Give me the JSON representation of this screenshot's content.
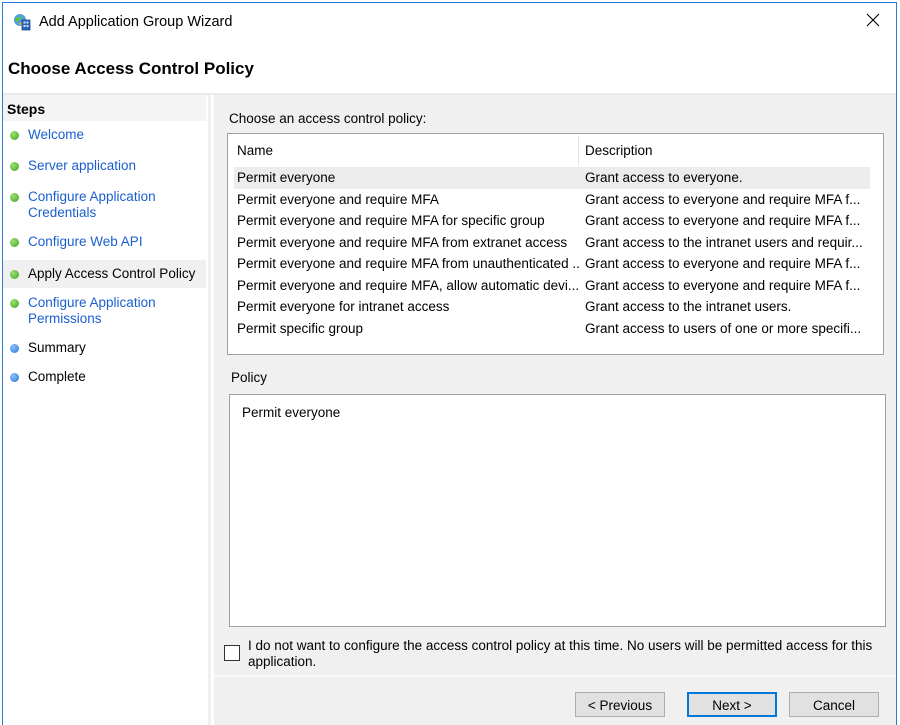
{
  "window": {
    "title": "Add Application Group Wizard",
    "app_icon": "adfs-app-icon",
    "close_icon": "close-icon"
  },
  "page_title": "Choose Access Control Policy",
  "steps": {
    "heading": "Steps",
    "items": [
      {
        "label": "Welcome",
        "status": "completed",
        "style": "link"
      },
      {
        "label": "Server application",
        "status": "completed",
        "style": "link"
      },
      {
        "label": "Configure Application Credentials",
        "status": "completed",
        "style": "link"
      },
      {
        "label": "Configure Web API",
        "status": "completed",
        "style": "link"
      },
      {
        "label": "Apply Access Control Policy",
        "status": "current",
        "style": "plain"
      },
      {
        "label": "Configure Application Permissions",
        "status": "completed",
        "style": "link"
      },
      {
        "label": "Summary",
        "status": "pending",
        "style": "plain"
      },
      {
        "label": "Complete",
        "status": "pending",
        "style": "plain"
      }
    ]
  },
  "policy_list": {
    "label": "Choose an access control policy:",
    "columns": [
      "Name",
      "Description"
    ],
    "selected_index": 0,
    "rows": [
      {
        "name": "Permit everyone",
        "description": "Grant access to everyone."
      },
      {
        "name": "Permit everyone and require MFA",
        "description": "Grant access to everyone and require MFA f..."
      },
      {
        "name": "Permit everyone and require MFA for specific group",
        "description": "Grant access to everyone and require MFA f..."
      },
      {
        "name": "Permit everyone and require MFA from extranet access",
        "description": "Grant access to the intranet users and requir..."
      },
      {
        "name": "Permit everyone and require MFA from unauthenticated ...",
        "description": "Grant access to everyone and require MFA f..."
      },
      {
        "name": "Permit everyone and require MFA, allow automatic devi...",
        "description": "Grant access to everyone and require MFA f..."
      },
      {
        "name": "Permit everyone for intranet access",
        "description": "Grant access to the intranet users."
      },
      {
        "name": "Permit specific group",
        "description": "Grant access to users of one or more specifi..."
      }
    ]
  },
  "policy": {
    "label": "Policy",
    "value": "Permit everyone"
  },
  "skip_checkbox": {
    "checked": false,
    "label": "I do not want to configure the access control policy at this time.  No users will be permitted access for this application."
  },
  "buttons": {
    "previous": "< Previous",
    "next": "Next >",
    "cancel": "Cancel"
  },
  "colors": {
    "window_border": "#2b7bd6",
    "link": "#1a5fd0",
    "primary_button_border": "#0078d7",
    "completed_dot": "#3fa12a",
    "pending_dot": "#2a6fd6"
  }
}
